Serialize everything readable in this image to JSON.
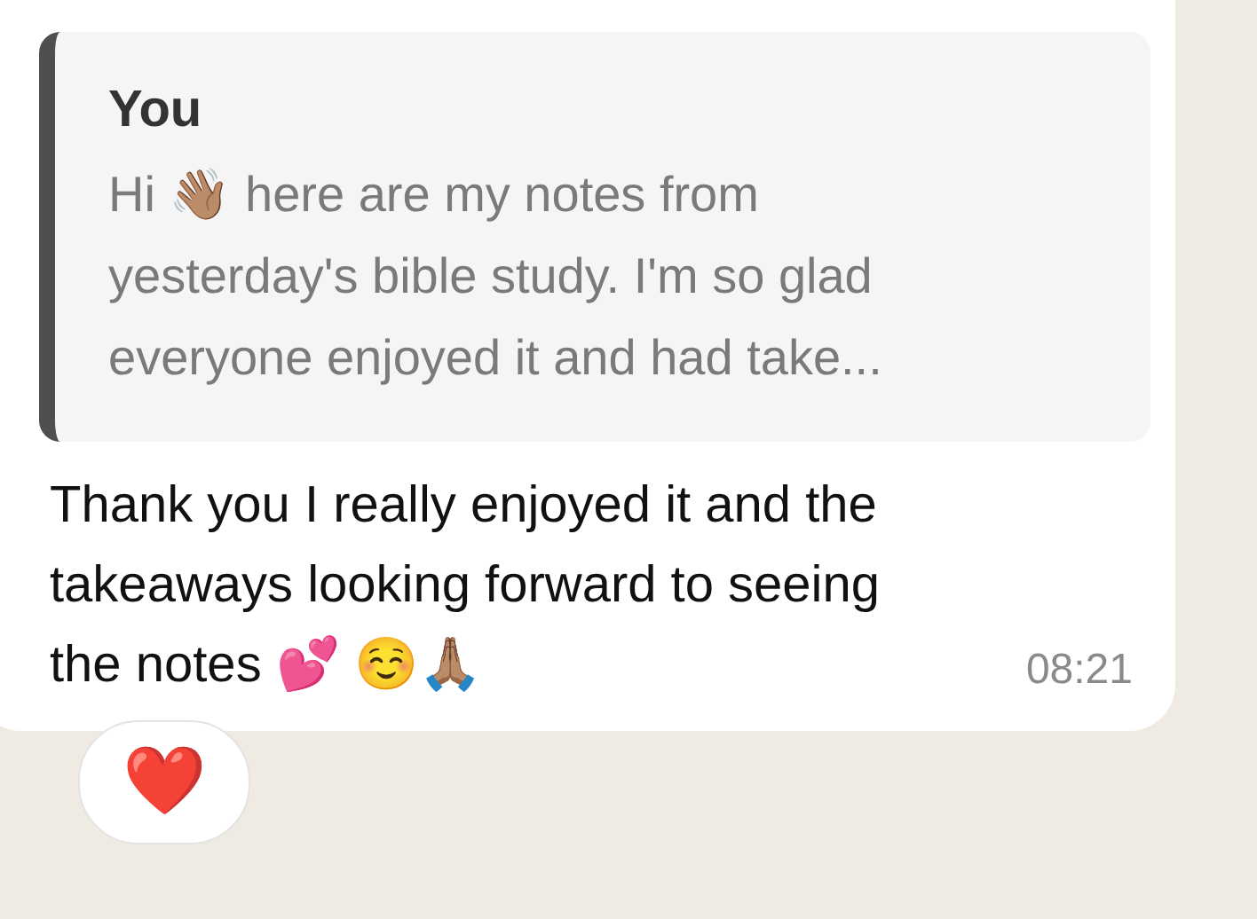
{
  "message": {
    "quote": {
      "author": "You",
      "text": "Hi 👋🏽 here are my notes from yesterday's bible study. I'm so glad everyone enjoyed it and had take..."
    },
    "text": "Thank you I really enjoyed it and the takeaways looking forward to seeing the notes 💕 ☺️🙏🏽",
    "time": "08:21",
    "reactions": [
      "❤️"
    ]
  }
}
